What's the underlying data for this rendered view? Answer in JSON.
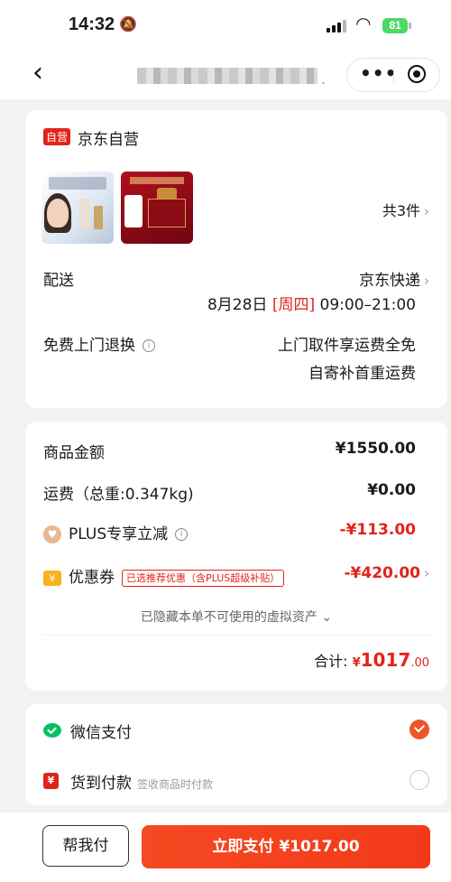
{
  "status_bar": {
    "time": "14:32",
    "battery": "81"
  },
  "nav": {
    "more_label": "•••"
  },
  "shop": {
    "tag": "自营",
    "name": "京东自营"
  },
  "items": {
    "count_label": "共3件"
  },
  "delivery": {
    "label": "配送",
    "carrier": "京东快递",
    "date": "8月28日",
    "weekday": "[周四]",
    "time_window": "09:00–21:00"
  },
  "returns": {
    "label": "免费上门退换",
    "line1": "上门取件享运费全免",
    "line2": "自寄补首重运费"
  },
  "summary": {
    "goods_label": "商品金额",
    "goods_value": "¥1550.00",
    "shipping_label": "运费（总重:0.347kg)",
    "shipping_value": "¥0.00",
    "plus_label": "PLUS专享立减",
    "plus_value": "-¥113.00",
    "coupon_label": "优惠券",
    "coupon_tag": "已选推荐优惠（含PLUS超级补贴）",
    "coupon_value": "-¥420.00",
    "hidden_note": "已隐藏本单不可使用的虚拟资产",
    "total_label": "合计:",
    "total_yen": "¥",
    "total_int": "1017",
    "total_dec": ".00"
  },
  "payment": {
    "wechat_label": "微信支付",
    "cod_label": "货到付款",
    "cod_sub": "签收商品时付款"
  },
  "bottom": {
    "help_label": "帮我付",
    "pay_label": "立即支付 ¥1017.00"
  },
  "colors": {
    "accent_red": "#e2231a",
    "pay_orange": "#f23a1a",
    "wechat_green": "#07c160"
  }
}
